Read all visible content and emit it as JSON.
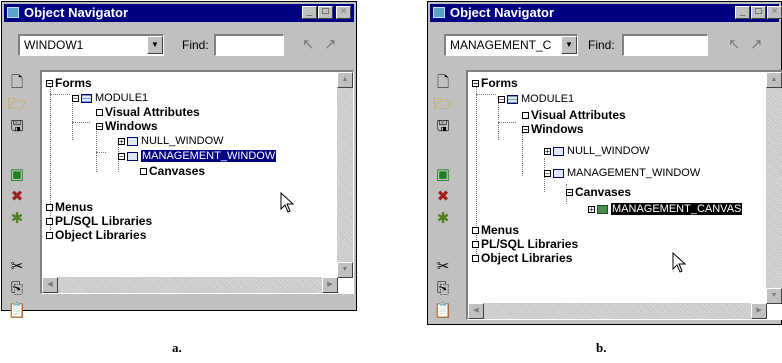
{
  "panel_a": {
    "title": "Object Navigator",
    "window_buttons": [
      "_",
      "□",
      "×"
    ],
    "combo_value": "WINDOW1",
    "find_label": "Find:",
    "find_value": "",
    "tree": {
      "forms": "Forms",
      "module": "MODULE1",
      "visual_attributes": "Visual Attributes",
      "windows": "Windows",
      "null_window": "NULL_WINDOW",
      "management_window": "MANAGEMENT_WINDOW",
      "canvases": "Canvases",
      "menus": "Menus",
      "plsql_libraries": "PL/SQL Libraries",
      "object_libraries": "Object Libraries"
    },
    "selected": "MANAGEMENT_WINDOW",
    "caption": "a."
  },
  "panel_b": {
    "title": "Object Navigator",
    "window_buttons": [
      "_",
      "□",
      "×"
    ],
    "combo_value": "MANAGEMENT_C",
    "find_label": "Find:",
    "find_value": "",
    "tree": {
      "forms": "Forms",
      "module": "MODULE1",
      "visual_attributes": "Visual Attributes",
      "windows": "Windows",
      "null_window": "NULL_WINDOW",
      "management_window": "MANAGEMENT_WINDOW",
      "canvases": "Canvases",
      "management_canvas": "MANAGEMENT_CANVAS",
      "menus": "Menus",
      "plsql_libraries": "PL/SQL Libraries",
      "object_libraries": "Object Libraries"
    },
    "selected": "MANAGEMENT_CANVAS",
    "caption": "b."
  },
  "toolbar_icons": [
    "new-icon",
    "open-icon",
    "save-icon",
    "run-icon",
    "delete-icon",
    "compile-icon",
    "cut-icon",
    "copy-icon",
    "paste-icon"
  ],
  "colors": {
    "titlebar": "#000080",
    "window": "#c0c0c0",
    "selection_a": "#000080",
    "selection_b": "#000000"
  }
}
